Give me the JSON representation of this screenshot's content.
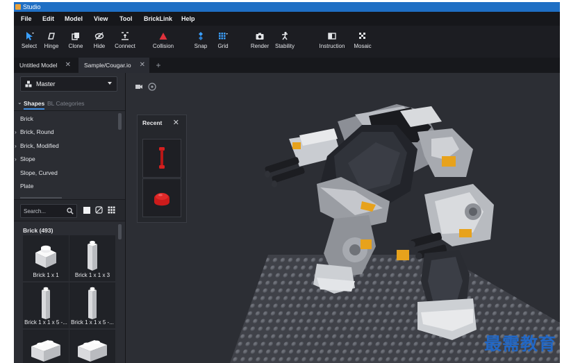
{
  "window": {
    "title": "Studio"
  },
  "menu": [
    "File",
    "Edit",
    "Model",
    "View",
    "Tool",
    "BrickLink",
    "Help"
  ],
  "toolbar": {
    "select": "Select",
    "hinge": "Hinge",
    "clone": "Clone",
    "hide": "Hide",
    "connect": "Connect",
    "collision": "Collision",
    "snap": "Snap",
    "grid": "Grid",
    "render": "Render",
    "stability": "Stability",
    "instruction": "Instruction",
    "mosaic": "Mosaic"
  },
  "tabs": [
    {
      "label": "Untitled Model",
      "close": "✕"
    },
    {
      "label": "Sample/Cougar.io",
      "close": "✕"
    }
  ],
  "tab_add": "+",
  "palette": {
    "selector": "Master",
    "shape_tabs": [
      "Shapes",
      "BL Categories"
    ],
    "categories": [
      {
        "label": "Brick",
        "expandable": false
      },
      {
        "label": "Brick, Round",
        "expandable": true
      },
      {
        "label": "Brick, Modified",
        "expandable": true
      },
      {
        "label": "Slope",
        "expandable": true
      },
      {
        "label": "Slope, Curved",
        "expandable": false
      },
      {
        "label": "Plate",
        "expandable": false
      }
    ],
    "search_placeholder": "Search...",
    "group_title": "Brick (493)",
    "bricks": [
      "Brick 1 x 1",
      "Brick 1 x 1 x 3",
      "Brick 1 x 1 x 5 -...",
      "Brick 1 x 1 x 5 -...",
      "",
      ""
    ]
  },
  "recent": {
    "title": "Recent",
    "close": "✕"
  },
  "colors": {
    "accent_blue": "#1f6fc4",
    "collision_red": "#e0323c",
    "recent_part_red": "#cc1b1b",
    "baseplate": "#3f4148",
    "watermark": "#2267c4"
  },
  "watermark": "最需教育"
}
